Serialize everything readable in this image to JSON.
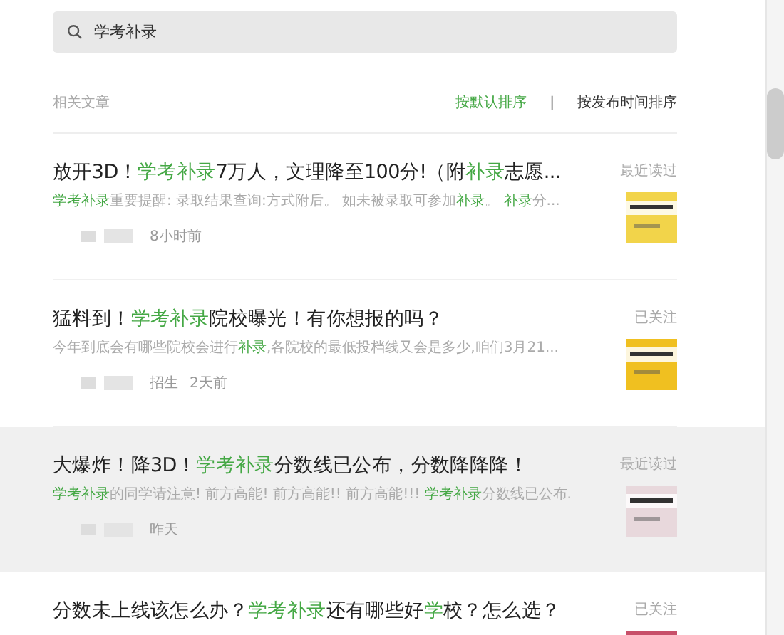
{
  "search": {
    "value": "学考补录"
  },
  "header": {
    "label": "相关文章",
    "sorts": [
      {
        "label": "按默认排序",
        "selected": true
      },
      {
        "label": "按发布时间排序",
        "selected": false
      }
    ],
    "separator": "|"
  },
  "articles": [
    {
      "title": [
        {
          "text": "放开3D！",
          "highlight": false
        },
        {
          "text": "学考补录",
          "highlight": true
        },
        {
          "text": "7万人，文理降至100分!（附",
          "highlight": false
        },
        {
          "text": "补录",
          "highlight": true
        },
        {
          "text": "志愿...",
          "highlight": false
        }
      ],
      "snippet": [
        {
          "text": "学考补录",
          "highlight": true
        },
        {
          "text": "重要提醒: 录取结果查询:方式附后。 如未被录取可参加",
          "highlight": false
        },
        {
          "text": "补录",
          "highlight": true
        },
        {
          "text": "。 ",
          "highlight": false
        },
        {
          "text": "补录",
          "highlight": true
        },
        {
          "text": "分...",
          "highlight": false
        }
      ],
      "time": "8小时前",
      "status": "最近读过",
      "selected": false
    },
    {
      "title": [
        {
          "text": "猛料到！",
          "highlight": false
        },
        {
          "text": "学考补录",
          "highlight": true
        },
        {
          "text": "院校曝光！有你想报的吗？",
          "highlight": false
        }
      ],
      "snippet": [
        {
          "text": "今年到底会有哪些院校会进行",
          "highlight": false
        },
        {
          "text": "补录",
          "highlight": true
        },
        {
          "text": ",各院校的最低投档线又会是多少,咱们3月21...",
          "highlight": false
        }
      ],
      "source": "招生",
      "time": "2天前",
      "status": "已关注",
      "selected": false
    },
    {
      "title": [
        {
          "text": "大爆炸！降3D！",
          "highlight": false
        },
        {
          "text": "学考补录",
          "highlight": true
        },
        {
          "text": "分数线已公布，分数降降降！",
          "highlight": false
        }
      ],
      "snippet": [
        {
          "text": "学考补录",
          "highlight": true
        },
        {
          "text": "的同学请注意! 前方高能! 前方高能!! 前方高能!!! ",
          "highlight": false
        },
        {
          "text": "学考补录",
          "highlight": true
        },
        {
          "text": "分数线已公布.",
          "highlight": false
        }
      ],
      "time": "昨天",
      "status": "最近读过",
      "selected": true
    },
    {
      "title": [
        {
          "text": "分数未上线该怎么办？",
          "highlight": false
        },
        {
          "text": "学考补录",
          "highlight": true
        },
        {
          "text": "还有哪些好",
          "highlight": false
        },
        {
          "text": "学",
          "highlight": true
        },
        {
          "text": "校？怎么选？",
          "highlight": false
        }
      ],
      "status": "已关注",
      "selected": false
    }
  ]
}
